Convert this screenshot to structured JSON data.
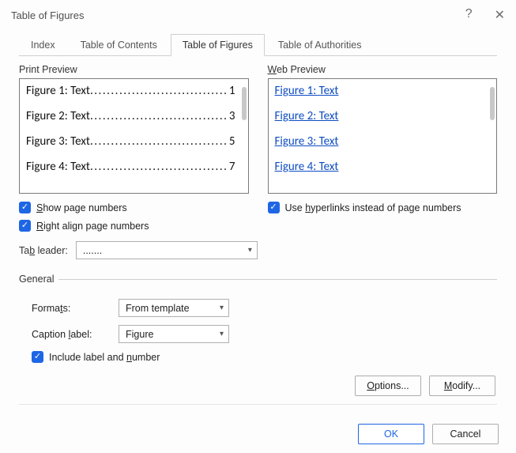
{
  "title": "Table of Figures",
  "help_char": "?",
  "close_char": "✕",
  "tabs": {
    "index": "Index",
    "toc": "Table of Contents",
    "tof": "Table of Figures",
    "toa": "Table of Authorities"
  },
  "active_tab": "tof",
  "print_preview": {
    "label": "Print Preview",
    "items": [
      {
        "text": "Figure 1: Text",
        "page": "1"
      },
      {
        "text": "Figure 2: Text",
        "page": "3"
      },
      {
        "text": "Figure 3: Text",
        "page": "5"
      },
      {
        "text": "Figure 4: Text",
        "page": "7"
      }
    ]
  },
  "web_preview": {
    "label": "Web Preview",
    "label_prefix_underline": "W",
    "label_rest": "eb Preview",
    "items": [
      "Figure 1: Text",
      "Figure 2: Text",
      "Figure 3: Text",
      "Figure 4: Text"
    ]
  },
  "checkboxes": {
    "show_page_numbers_u": "S",
    "show_page_numbers_rest": "how page numbers",
    "right_align_u": "R",
    "right_align_rest": "ight align page numbers",
    "use_hyperlinks_pre": "Use ",
    "use_hyperlinks_u": "h",
    "use_hyperlinks_rest": "yperlinks instead of page numbers",
    "include_label_pre": "Include label and ",
    "include_label_u": "n",
    "include_label_rest": "umber"
  },
  "tab_leader": {
    "label_pre": "Ta",
    "label_u": "b",
    "label_rest": " leader:",
    "value": "......."
  },
  "general": {
    "legend": "General",
    "formats_label_pre": "Forma",
    "formats_label_u": "t",
    "formats_label_rest": "s:",
    "formats_value": "From template",
    "caption_label_pre": "Caption ",
    "caption_label_u": "l",
    "caption_label_rest": "abel:",
    "caption_value": "Figure"
  },
  "buttons": {
    "options_u": "O",
    "options_rest": "ptions...",
    "modify_u": "M",
    "modify_rest": "odify...",
    "ok": "OK",
    "cancel": "Cancel"
  },
  "leader_glyph": "...................................."
}
